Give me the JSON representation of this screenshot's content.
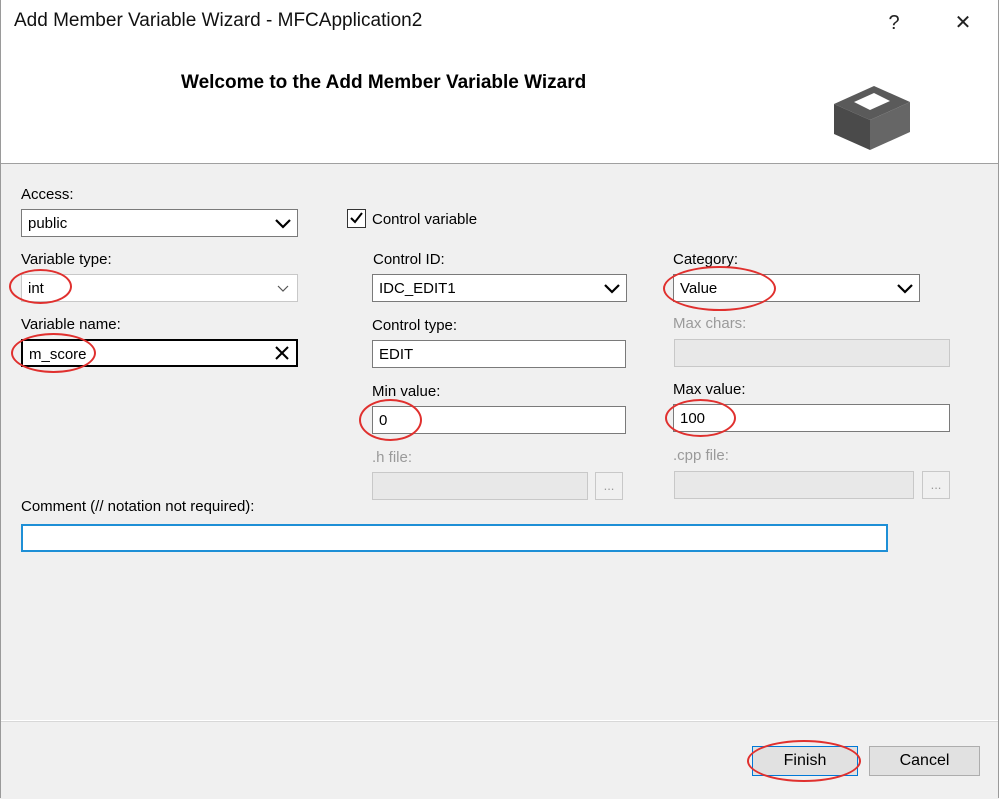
{
  "window": {
    "title": "Add Member Variable Wizard - MFCApplication2",
    "help_glyph": "?",
    "close_glyph": "✕"
  },
  "header": {
    "welcome": "Welcome to the Add Member Variable Wizard",
    "icon": "box-icon"
  },
  "form": {
    "access": {
      "label": "Access:",
      "value": "public"
    },
    "variable_type": {
      "label": "Variable type:",
      "value": "int"
    },
    "variable_name": {
      "label": "Variable name:",
      "value": "m_score"
    },
    "control_variable": {
      "label": "Control variable",
      "checked": true
    },
    "control_id": {
      "label": "Control ID:",
      "value": "IDC_EDIT1"
    },
    "control_type": {
      "label": "Control type:",
      "value": "EDIT"
    },
    "min_value": {
      "label": "Min value:",
      "value": "0"
    },
    "h_file": {
      "label": ".h file:",
      "value": "",
      "browse": "..."
    },
    "category": {
      "label": "Category:",
      "value": "Value"
    },
    "max_chars": {
      "label": "Max chars:",
      "value": ""
    },
    "max_value": {
      "label": "Max value:",
      "value": "100"
    },
    "cpp_file": {
      "label": ".cpp file:",
      "value": "",
      "browse": "..."
    },
    "comment": {
      "label": "Comment (// notation not required):",
      "value": ""
    }
  },
  "buttons": {
    "finish": "Finish",
    "cancel": "Cancel"
  },
  "colors": {
    "annotation_ring": "#e0302e",
    "focus_border": "#1e8fd6",
    "default_button_border": "#0078d7",
    "panel_bg": "#f0f0f0"
  }
}
